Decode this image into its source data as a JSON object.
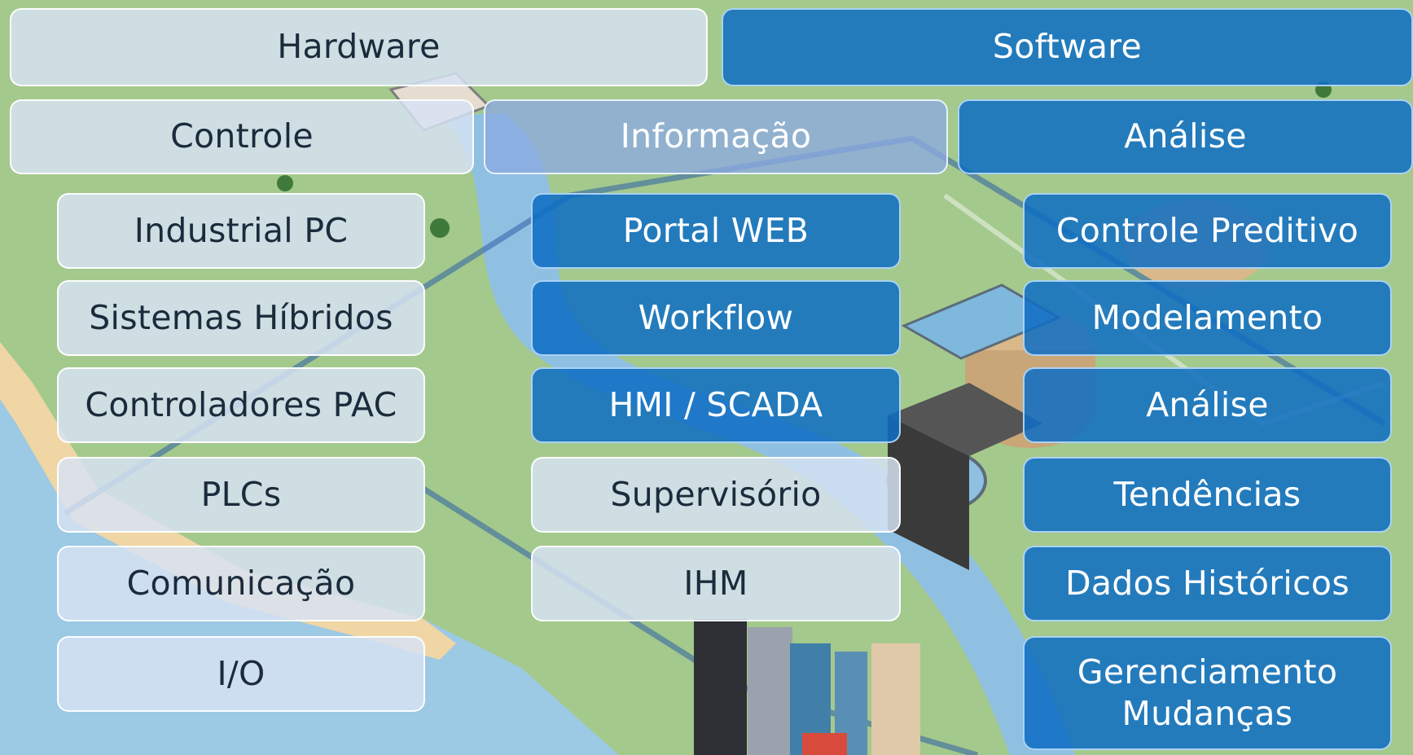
{
  "colors": {
    "light_box": "#d6e2f3",
    "dark_box": "#0e6ec4",
    "mid_box": "#8caae2",
    "light_text": "#1c2b3c",
    "dark_text": "#ffffff"
  },
  "top_row": {
    "hardware": "Hardware",
    "software": "Software"
  },
  "category_row": {
    "controle": "Controle",
    "informacao": "Informação",
    "analise": "Análise"
  },
  "columns": {
    "controle": [
      "Industrial PC",
      "Sistemas Híbridos",
      "Controladores PAC",
      "PLCs",
      "Comunicação",
      "I/O"
    ],
    "informacao": [
      "Portal WEB",
      "Workflow",
      "HMI / SCADA",
      "Supervisório",
      "IHM"
    ],
    "analise": [
      "Controle Preditivo",
      "Modelamento",
      "Análise",
      "Tendências",
      "Dados Históricos"
    ],
    "analise_last": [
      "Gerenciamento",
      "Mudanças"
    ]
  }
}
